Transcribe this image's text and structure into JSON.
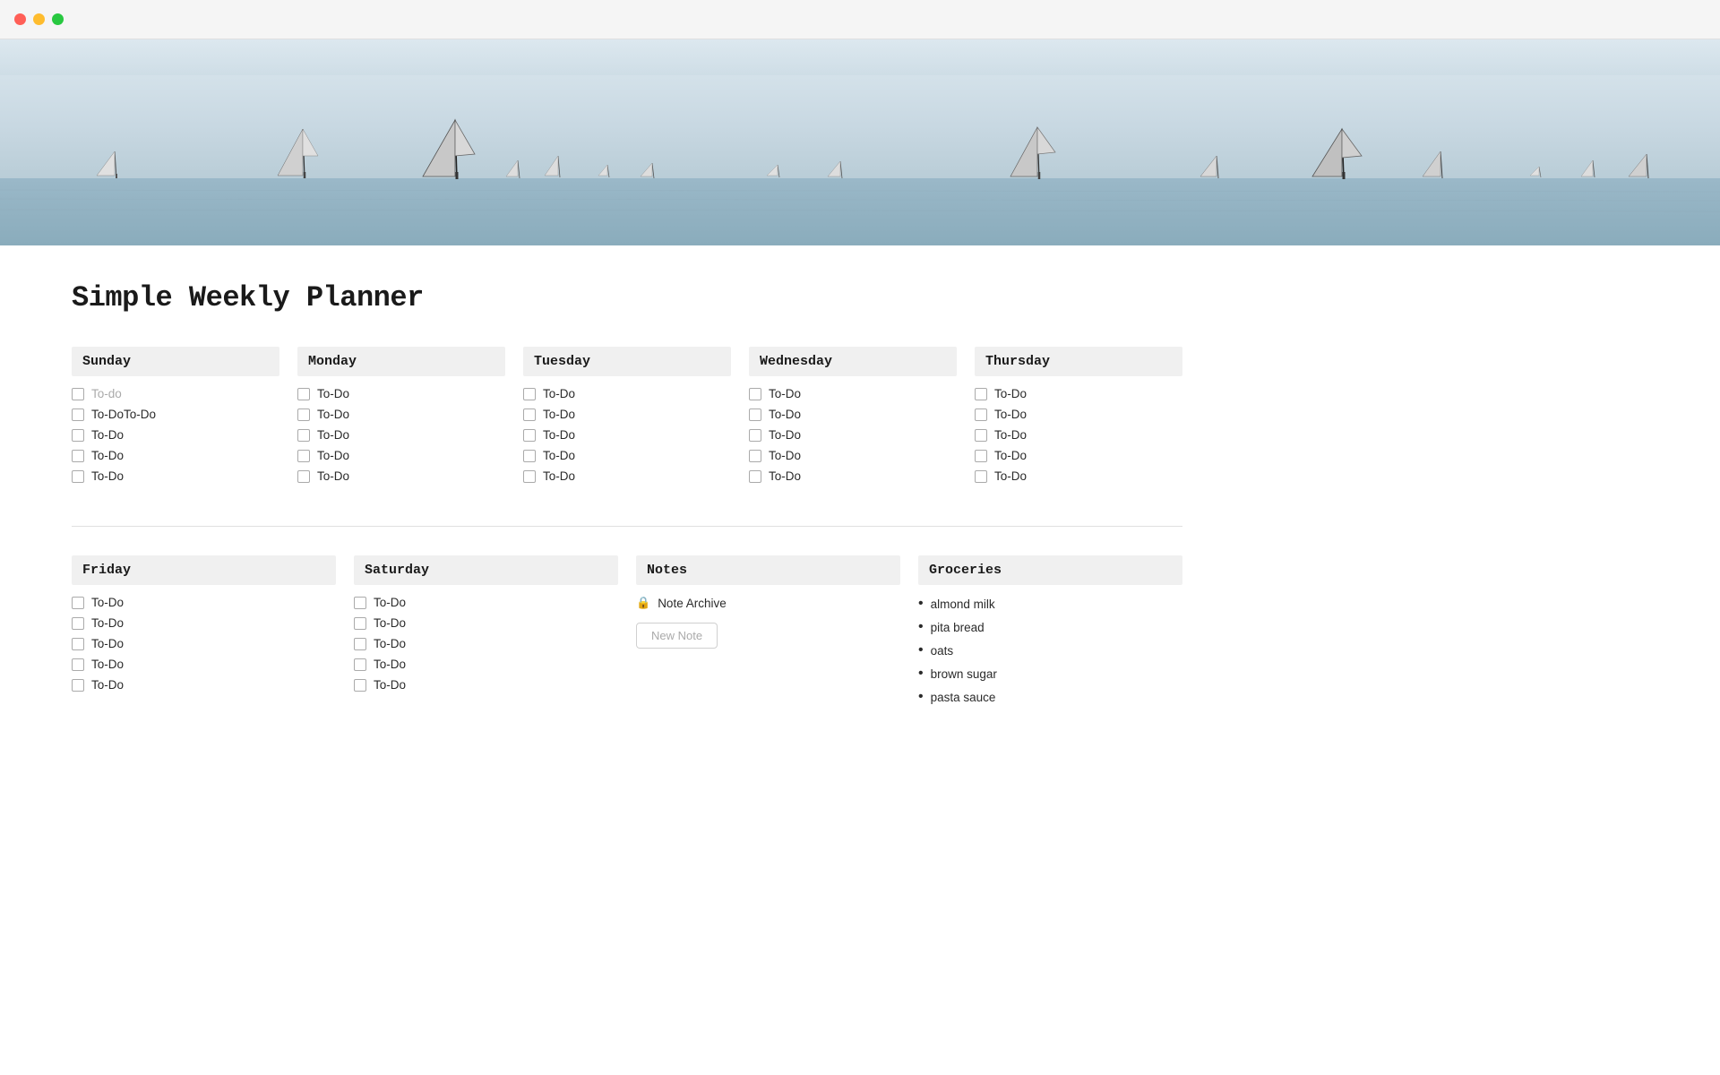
{
  "titlebar": {
    "dots": [
      "red",
      "yellow",
      "green"
    ]
  },
  "page": {
    "title": "Simple Weekly Planner"
  },
  "week_row1": [
    {
      "day": "Sunday",
      "todos": [
        {
          "label": "To-do",
          "placeholder": true
        },
        {
          "label": "To-DoTo-Do",
          "placeholder": false
        },
        {
          "label": "To-Do",
          "placeholder": false
        },
        {
          "label": "To-Do",
          "placeholder": false
        },
        {
          "label": "To-Do",
          "placeholder": false
        }
      ]
    },
    {
      "day": "Monday",
      "todos": [
        {
          "label": "To-Do",
          "placeholder": false
        },
        {
          "label": "To-Do",
          "placeholder": false
        },
        {
          "label": "To-Do",
          "placeholder": false
        },
        {
          "label": "To-Do",
          "placeholder": false
        },
        {
          "label": "To-Do",
          "placeholder": false
        }
      ]
    },
    {
      "day": "Tuesday",
      "todos": [
        {
          "label": "To-Do",
          "placeholder": false
        },
        {
          "label": "To-Do",
          "placeholder": false
        },
        {
          "label": "To-Do",
          "placeholder": false
        },
        {
          "label": "To-Do",
          "placeholder": false
        },
        {
          "label": "To-Do",
          "placeholder": false
        }
      ]
    },
    {
      "day": "Wednesday",
      "todos": [
        {
          "label": "To-Do",
          "placeholder": false
        },
        {
          "label": "To-Do",
          "placeholder": false
        },
        {
          "label": "To-Do",
          "placeholder": false
        },
        {
          "label": "To-Do",
          "placeholder": false
        },
        {
          "label": "To-Do",
          "placeholder": false
        }
      ]
    },
    {
      "day": "Thursday",
      "todos": [
        {
          "label": "To-Do",
          "placeholder": false
        },
        {
          "label": "To-Do",
          "placeholder": false
        },
        {
          "label": "To-Do",
          "placeholder": false
        },
        {
          "label": "To-Do",
          "placeholder": false
        },
        {
          "label": "To-Do",
          "placeholder": false
        }
      ]
    }
  ],
  "week_row2_days": [
    {
      "day": "Friday",
      "todos": [
        {
          "label": "To-Do"
        },
        {
          "label": "To-Do"
        },
        {
          "label": "To-Do"
        },
        {
          "label": "To-Do"
        },
        {
          "label": "To-Do"
        }
      ]
    },
    {
      "day": "Saturday",
      "todos": [
        {
          "label": "To-Do"
        },
        {
          "label": "To-Do"
        },
        {
          "label": "To-Do"
        },
        {
          "label": "To-Do"
        },
        {
          "label": "To-Do"
        }
      ]
    }
  ],
  "notes": {
    "header": "Notes",
    "archive_label": "Note Archive",
    "new_note_label": "New Note"
  },
  "groceries": {
    "header": "Groceries",
    "items": [
      "almond milk",
      "pita bread",
      "oats",
      "brown sugar",
      "pasta sauce"
    ]
  }
}
